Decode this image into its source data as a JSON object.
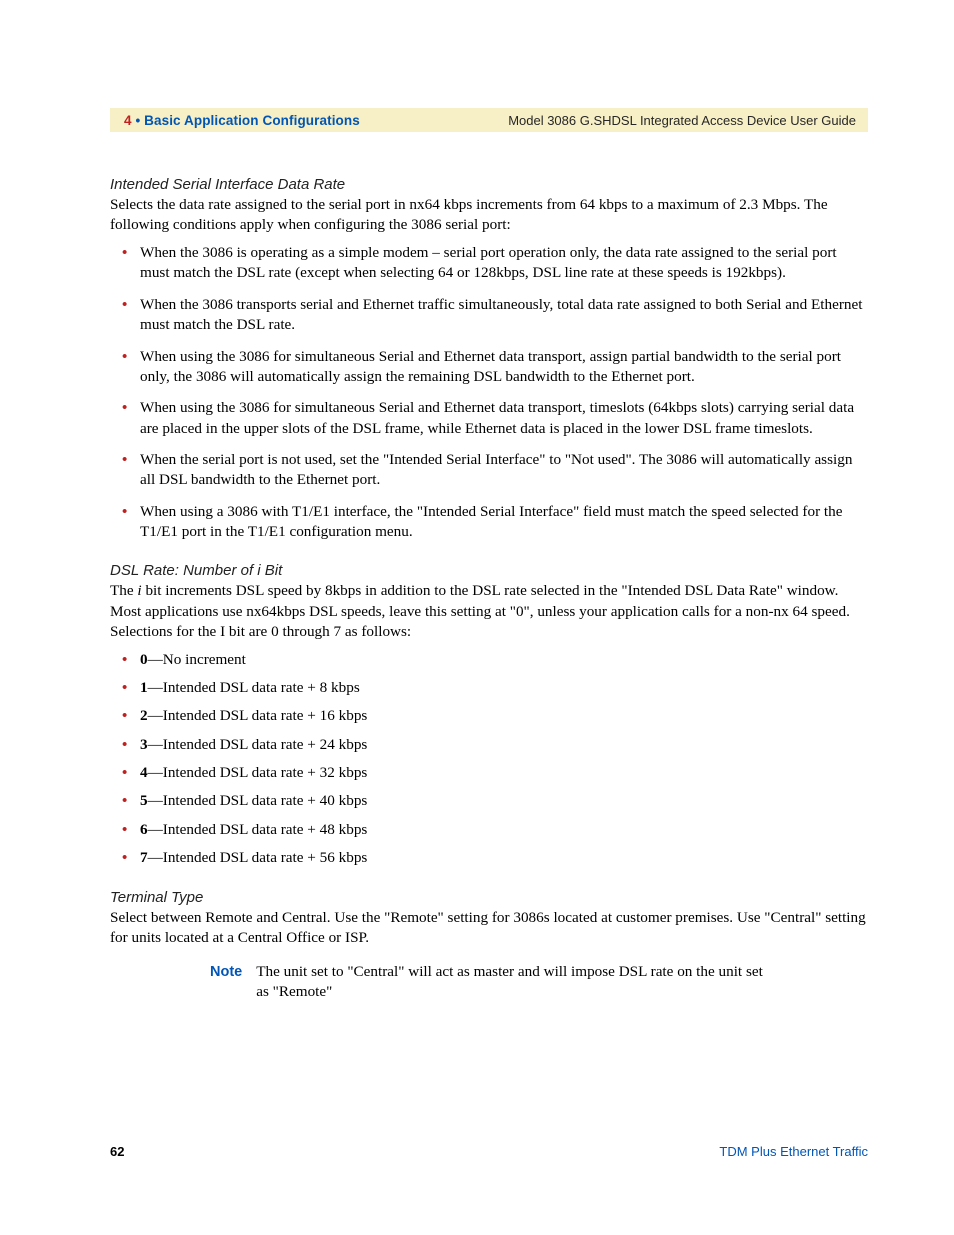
{
  "header": {
    "chapter_number": "4",
    "bullet": " • ",
    "chapter_title": "Basic Application Configurations",
    "guide_title": "Model 3086 G.SHDSL Integrated Access Device User Guide"
  },
  "sections": {
    "serial": {
      "title": "Intended Serial Interface Data Rate",
      "intro": "Selects the data rate assigned to the serial port in nx64 kbps increments from 64 kbps to a maximum of 2.3 Mbps. The following conditions apply when configuring the 3086 serial port:",
      "bullets": [
        "When the 3086 is operating as a simple modem – serial port operation only, the data rate assigned to the serial port must match the DSL rate (except when selecting 64 or 128kbps, DSL line rate at these speeds is 192kbps).",
        "When the 3086 transports serial and Ethernet traffic simultaneously, total data rate assigned to both Serial and Ethernet must match the DSL rate.",
        "When using the 3086 for simultaneous Serial and Ethernet data transport, assign partial bandwidth to the serial port only, the 3086 will automatically assign the remaining DSL bandwidth to the Ethernet port.",
        "When using the 3086 for simultaneous Serial and Ethernet data transport, timeslots (64kbps slots) carrying serial data are placed in the upper slots of the DSL frame, while Ethernet data is placed in the lower DSL frame timeslots.",
        "When the serial port is not used, set the \"Intended Serial Interface\" to \"Not used\". The 3086 will automatically assign all DSL bandwidth to the Ethernet port.",
        "When using a 3086 with T1/E1 interface, the \"Intended Serial Interface\" field must match the speed selected for the T1/E1 port in the T1/E1 configuration menu."
      ]
    },
    "dsl": {
      "title": "DSL Rate: Number of i Bit",
      "intro_pre": "The ",
      "intro_i": "i",
      "intro_post": " bit increments DSL speed by 8kbps in addition to the DSL rate selected in the \"Intended DSL Data Rate\" window. Most applications use nx64kbps DSL speeds, leave this setting at \"0\", unless your application calls for a non-nx 64 speed.  Selections for the I bit are 0 through 7 as follows:",
      "bullets": [
        {
          "n": "0",
          "t": "—No increment"
        },
        {
          "n": "1",
          "t": "—Intended DSL data rate + 8 kbps"
        },
        {
          "n": "2",
          "t": "—Intended DSL data rate + 16 kbps"
        },
        {
          "n": "3",
          "t": "—Intended DSL data rate + 24 kbps"
        },
        {
          "n": "4",
          "t": "—Intended DSL data rate + 32 kbps"
        },
        {
          "n": "5",
          "t": "—Intended DSL data rate + 40 kbps"
        },
        {
          "n": "6",
          "t": "—Intended DSL data rate + 48 kbps"
        },
        {
          "n": "7",
          "t": "—Intended DSL data rate + 56 kbps"
        }
      ]
    },
    "terminal": {
      "title": "Terminal Type",
      "intro": "Select between Remote and Central. Use the \"Remote\" setting for 3086s located at customer premises. Use \"Central\" setting for units located at a Central Office or ISP.",
      "note_label": "Note",
      "note_text": "The unit set to \"Central\" will act as master and will impose DSL rate on the unit set as \"Remote\""
    }
  },
  "footer": {
    "page_number": "62",
    "section_name": "TDM Plus Ethernet Traffic"
  }
}
